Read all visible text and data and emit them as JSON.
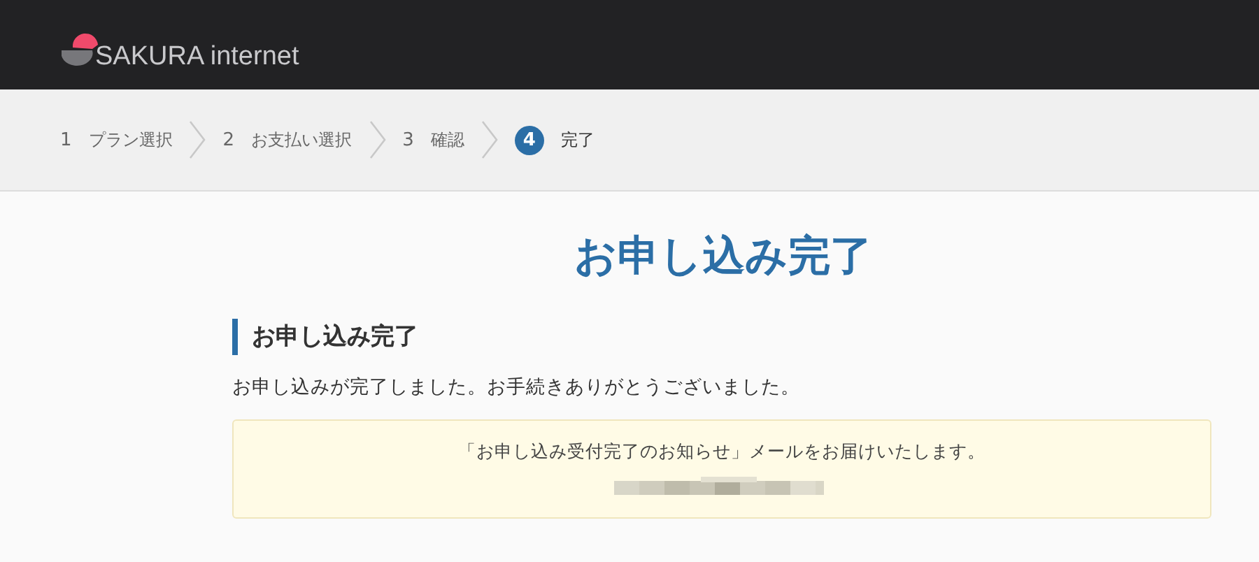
{
  "header": {
    "logo_text": "SAKURA internet"
  },
  "steps": [
    {
      "number": "1",
      "label": "プラン選択",
      "selected": false
    },
    {
      "number": "2",
      "label": "お支払い選択",
      "selected": false
    },
    {
      "number": "3",
      "label": "確認",
      "selected": false
    },
    {
      "number": "4",
      "label": "完了",
      "selected": true
    }
  ],
  "page_title": "お申し込み完了",
  "section": {
    "heading": "お申し込み完了",
    "message": "お申し込みが完了しました。お手続きありがとうございました。"
  },
  "notice": {
    "text": "「お申し込み受付完了のお知らせ」メールをお届けいたします。"
  }
}
